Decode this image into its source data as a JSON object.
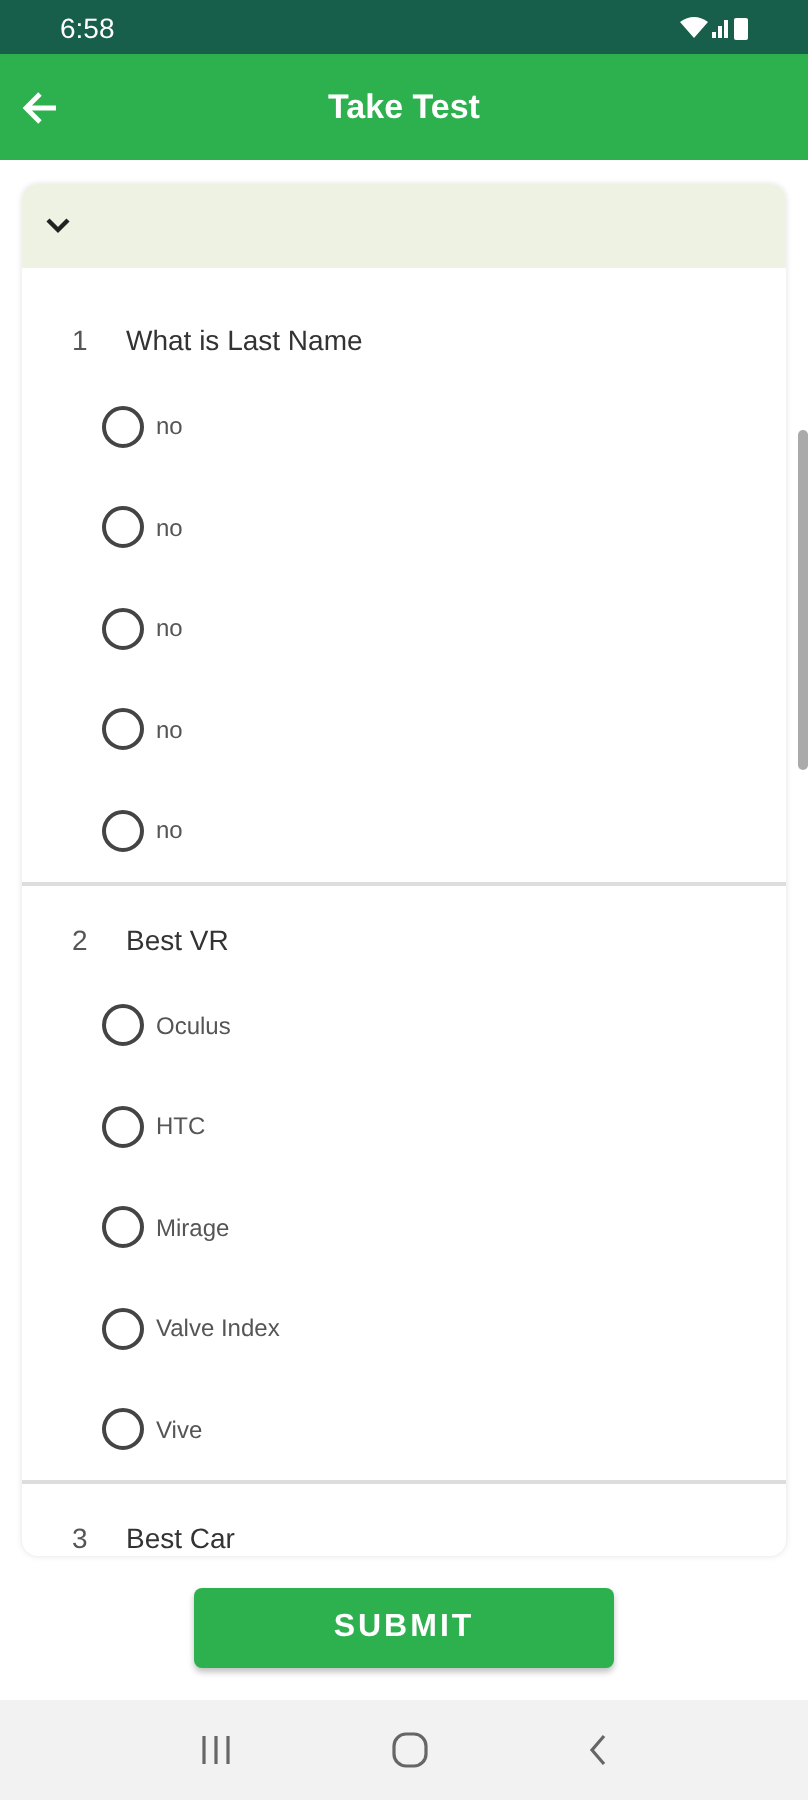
{
  "status_bar": {
    "time": "6:58"
  },
  "app_bar": {
    "title": "Take Test"
  },
  "questions": [
    {
      "number": "1",
      "text": "What is Last Name",
      "options": [
        {
          "label": "no",
          "selected": false
        },
        {
          "label": "no",
          "selected": false
        },
        {
          "label": "no",
          "selected": false
        },
        {
          "label": "no",
          "selected": false
        },
        {
          "label": "no",
          "selected": false
        }
      ]
    },
    {
      "number": "2",
      "text": "Best VR",
      "options": [
        {
          "label": "Oculus",
          "selected": false
        },
        {
          "label": "HTC",
          "selected": false
        },
        {
          "label": "Mirage",
          "selected": false
        },
        {
          "label": "Valve Index",
          "selected": false
        },
        {
          "label": "Vive",
          "selected": false
        }
      ]
    },
    {
      "number": "3",
      "text": "Best Car"
    }
  ],
  "submit": "SUBMIT"
}
